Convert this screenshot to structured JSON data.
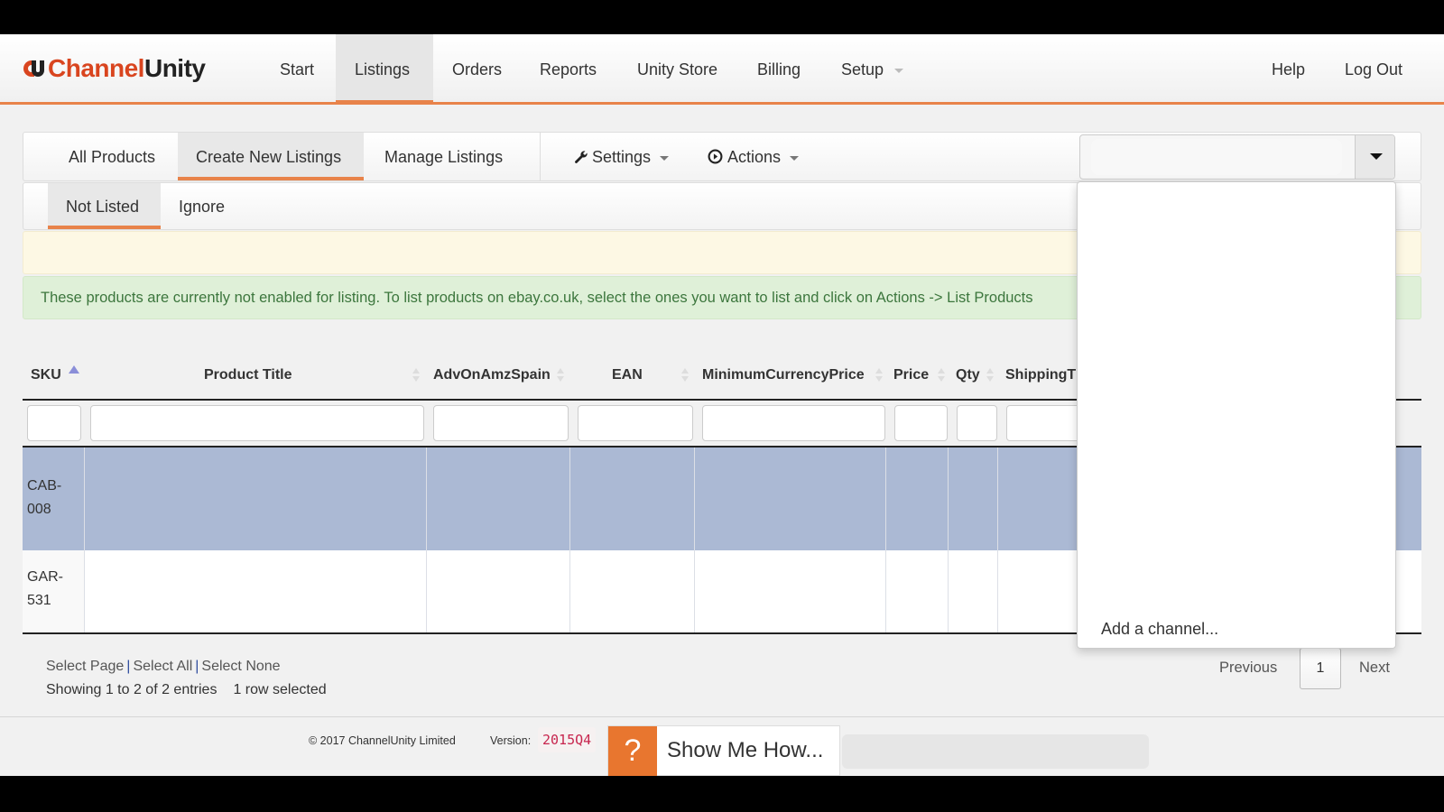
{
  "brand": {
    "name_part1": "Channel",
    "name_part2": "Unity",
    "accent": "#e8834a",
    "logo_red": "#d9451f"
  },
  "topnav": {
    "items": [
      {
        "label": "Start",
        "active": false
      },
      {
        "label": "Listings",
        "active": true
      },
      {
        "label": "Orders",
        "active": false
      },
      {
        "label": "Reports",
        "active": false
      },
      {
        "label": "Unity Store",
        "active": false
      },
      {
        "label": "Billing",
        "active": false
      },
      {
        "label": "Setup",
        "active": false,
        "dropdown": true
      }
    ],
    "right": [
      {
        "label": "Help"
      },
      {
        "label": "Log Out"
      }
    ]
  },
  "subnav": {
    "tabs": [
      {
        "label": "All Products",
        "active": false
      },
      {
        "label": "Create New Listings",
        "active": true
      },
      {
        "label": "Manage Listings",
        "active": false
      }
    ],
    "settings_label": "Settings",
    "settings_icon": "wrench-icon",
    "actions_label": "Actions",
    "actions_icon": "play-circle-icon",
    "channel_select": {
      "value": "",
      "icon": "caret-down-icon"
    }
  },
  "subtabs": [
    {
      "label": "Not Listed",
      "active": true
    },
    {
      "label": "Ignore",
      "active": false
    }
  ],
  "alerts": {
    "warning": "",
    "info": "These products are currently not enabled for listing. To list products on ebay.co.uk, select the ones you want to list and click on Actions -> List Products"
  },
  "table": {
    "columns": [
      {
        "label": "SKU",
        "sort": "asc"
      },
      {
        "label": "Product Title",
        "sort": "none"
      },
      {
        "label": "AdvOnAmzSpain",
        "sort": "none"
      },
      {
        "label": "EAN",
        "sort": "none"
      },
      {
        "label": "MinimumCurrencyPrice",
        "sort": "none"
      },
      {
        "label": "Price",
        "sort": "none"
      },
      {
        "label": "Qty",
        "sort": "none"
      },
      {
        "label": "ShippingT",
        "sort": "none"
      }
    ],
    "filters": [
      "",
      "",
      "",
      "",
      "",
      "",
      "",
      ""
    ],
    "rows": [
      {
        "sku": "CAB-008",
        "title": "",
        "adv": "",
        "ean": "",
        "min_price": "",
        "price": "",
        "qty": "",
        "shipping": "",
        "selected": true
      },
      {
        "sku": "GAR-531",
        "title": "",
        "adv": "",
        "ean": "",
        "min_price": "",
        "price": "",
        "qty": "",
        "shipping": "",
        "selected": false
      }
    ],
    "selection_color": "#abb9d4"
  },
  "table_footer": {
    "select_page": "Select Page",
    "select_all": "Select All",
    "select_none": "Select None",
    "separator": "|",
    "showing": "Showing 1 to 2 of 2 entries",
    "rows_selected": "1 row selected",
    "pagination": {
      "previous": "Previous",
      "current": "1",
      "next": "Next"
    }
  },
  "footer": {
    "copyright": "© 2017 ChannelUnity Limited",
    "version_label": "Version:",
    "version": "2015Q4",
    "help_icon": "?",
    "show_me_how": "Show Me How..."
  },
  "channel_dropdown": {
    "options": [
      {
        "label": "Add a channel..."
      }
    ]
  }
}
